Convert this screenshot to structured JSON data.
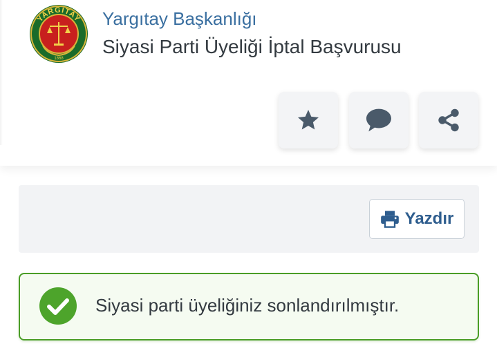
{
  "header": {
    "org_name": "Yargıtay Başkanlığı",
    "service_title": "Siyasi Parti Üyeliği İptal Başvurusu",
    "logo": {
      "icon": "yargitay-seal-logo",
      "text": "YARGITAY",
      "year": "1868"
    }
  },
  "actions": [
    {
      "icon": "star-icon"
    },
    {
      "icon": "comment-icon"
    },
    {
      "icon": "share-icon"
    }
  ],
  "toolbar": {
    "print_label": "Yazdır",
    "print_icon": "printer-icon"
  },
  "alert": {
    "status": "success",
    "icon": "check-circle-icon",
    "message": "Siyasi parti üyeliğiniz sonlandırılmıştır."
  },
  "colors": {
    "org_name": "#3a6fa0",
    "print_label": "#2e5d8e",
    "success_border": "#4a9d26",
    "success_icon": "#4da42b",
    "action_icon": "#4a5a6a"
  }
}
